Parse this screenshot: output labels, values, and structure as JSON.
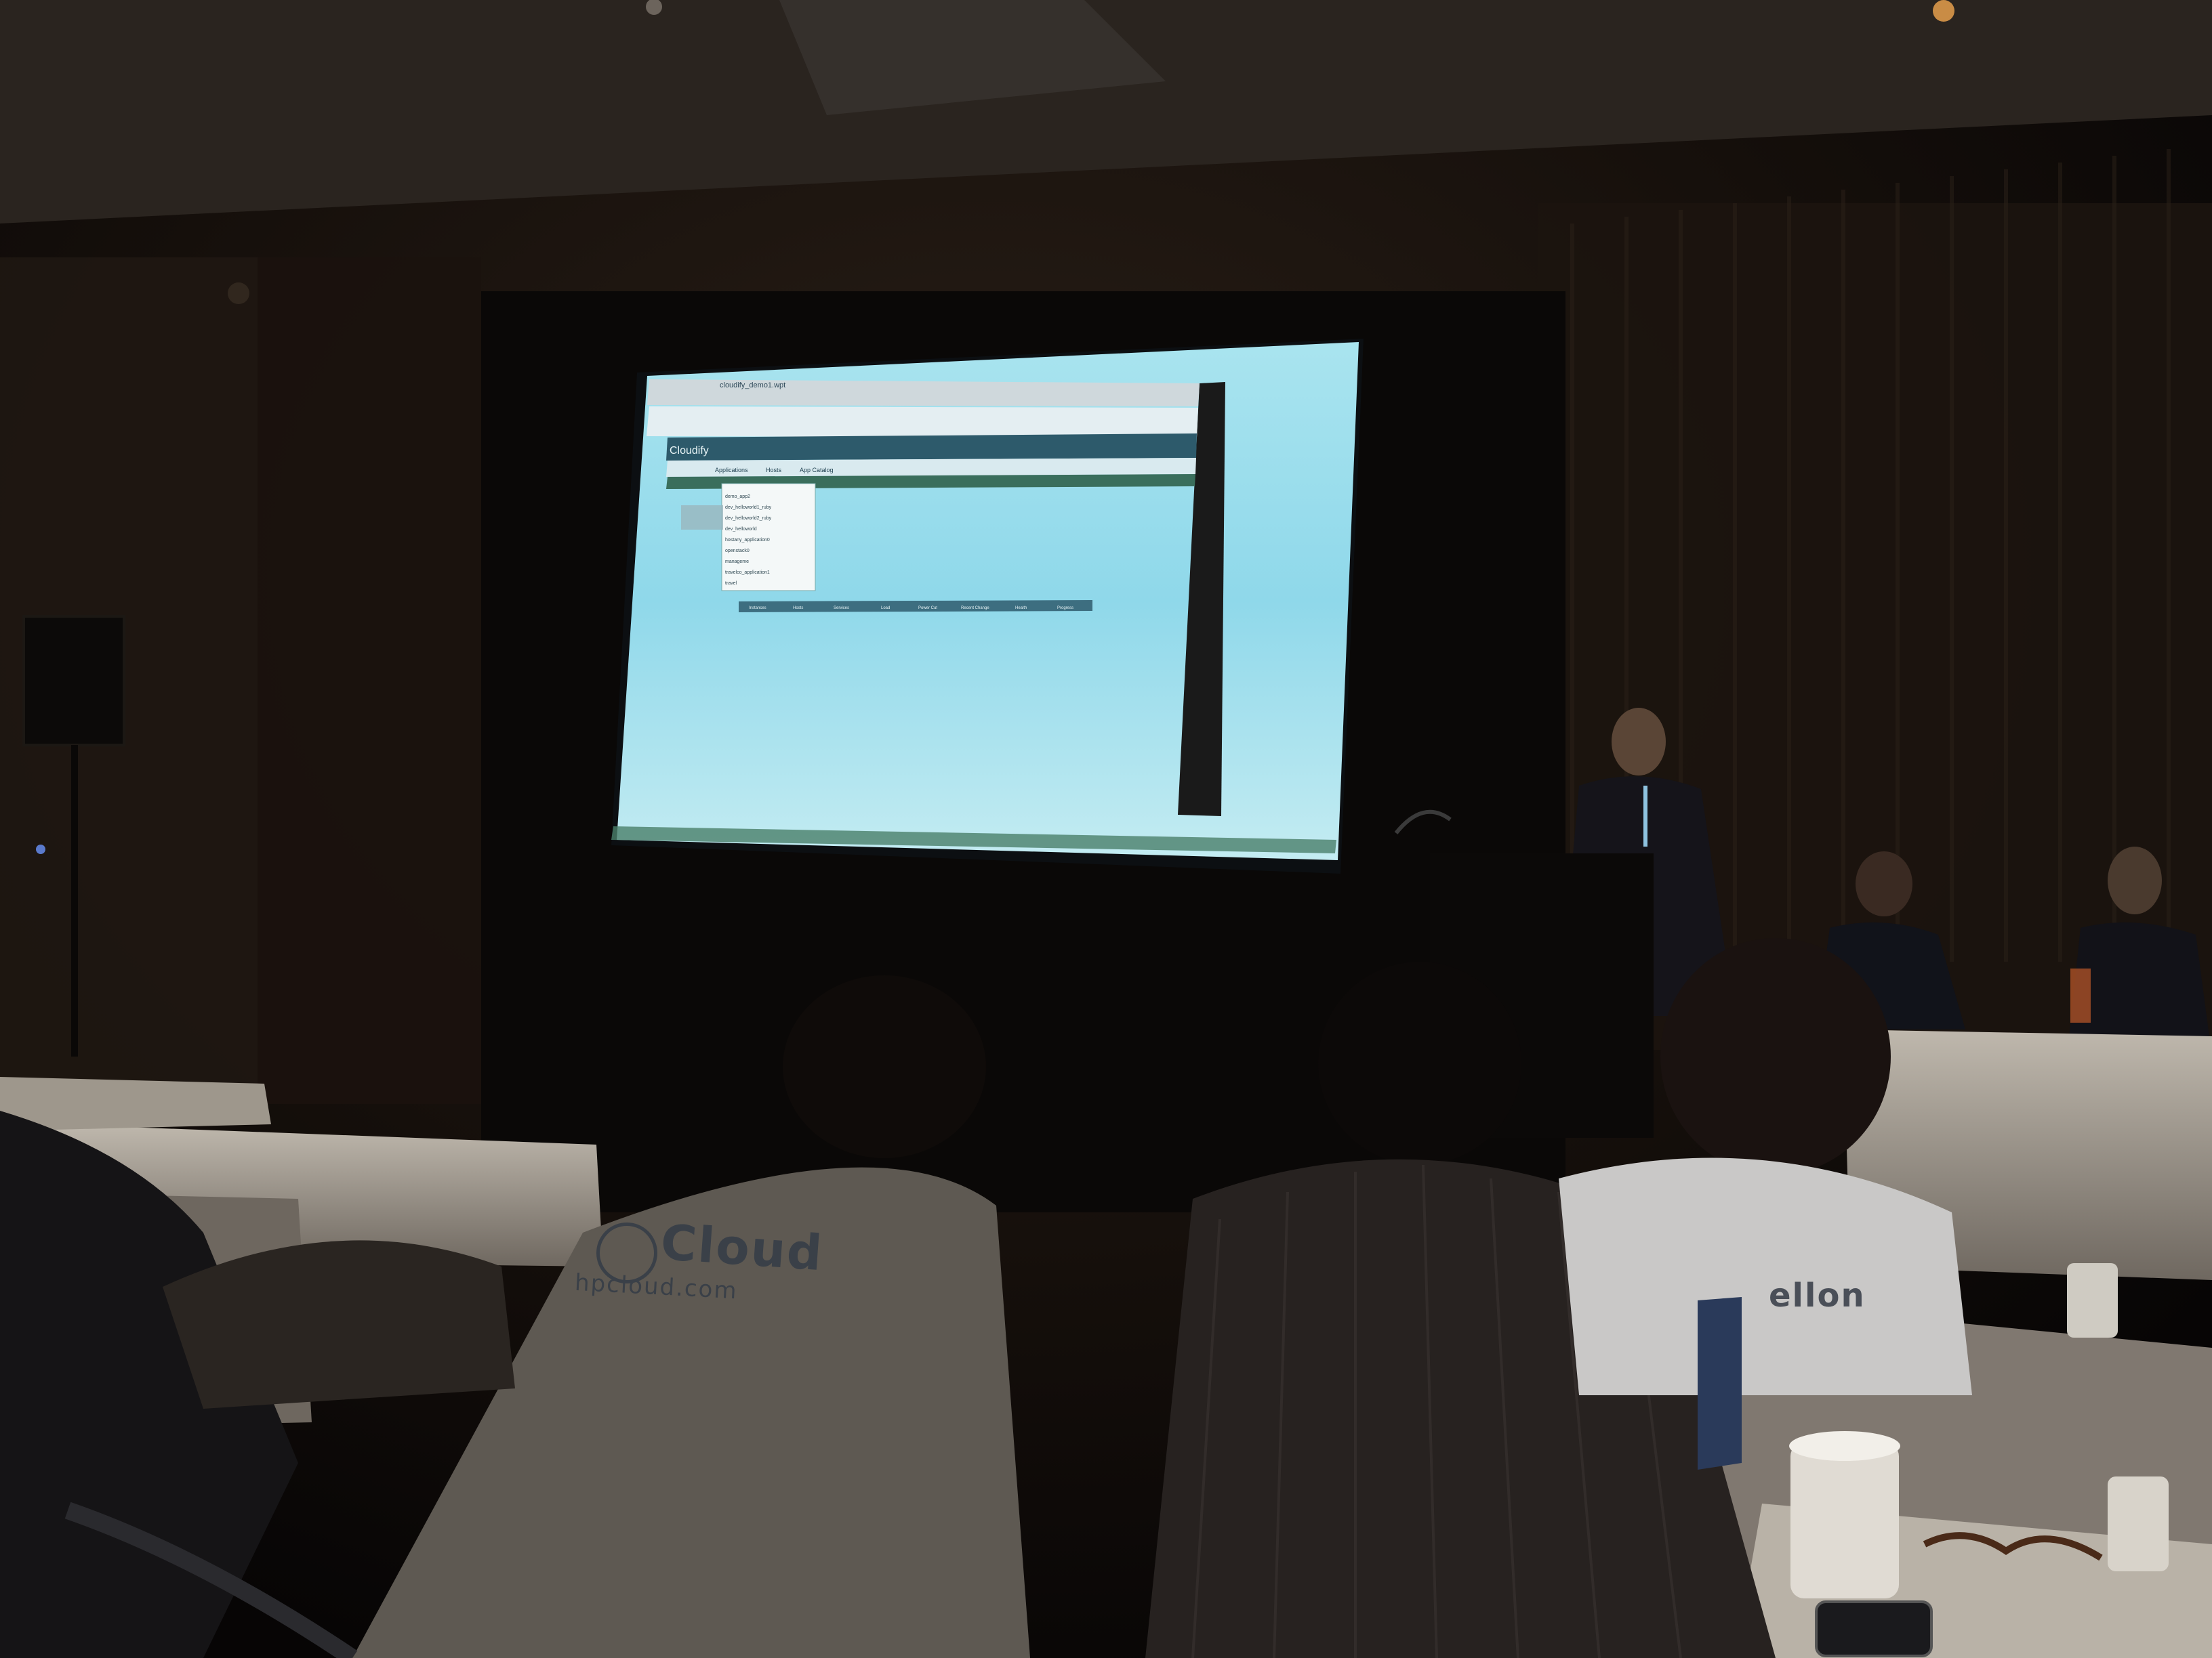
{
  "scene": {
    "description_colors": {
      "room": "#0d0b0a",
      "screen_glow": "#9ad6e8",
      "screen_header": "#2d5a6b"
    }
  },
  "projected_ui": {
    "brand": "Cloudify",
    "nav_items": [
      "Applications",
      "Hosts",
      "App Catalog"
    ],
    "dropdown_items": [
      "demo_app2",
      "dev_helloworld1_ruby",
      "dev_helloworld2_ruby",
      "dev_helloworld",
      "hostany_application0",
      "openstack0",
      "manageme",
      "travelco_application1",
      "travel"
    ],
    "table_headers": [
      "Instances",
      "Hosts",
      "Services",
      "Load",
      "Power Cut",
      "Recent Change",
      "Health",
      "Progress"
    ],
    "window_title": "cloudify_demo1.wpt"
  },
  "audience": {
    "shirt_logo_text": "Cloud",
    "shirt_url_text": "hpcloud.com",
    "shirt2_text": "ellon"
  }
}
